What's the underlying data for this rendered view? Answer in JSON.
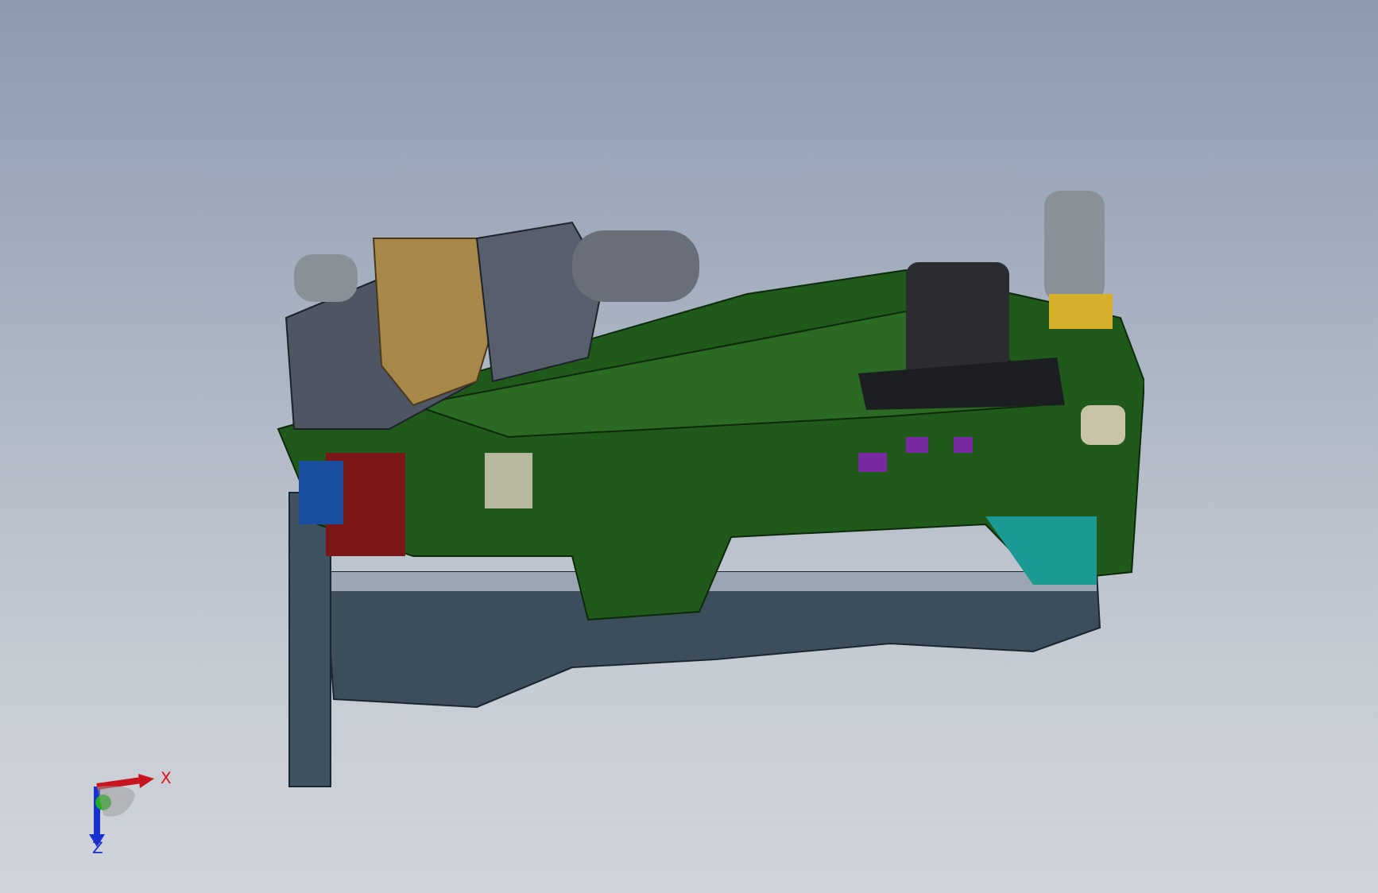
{
  "viewport": {
    "triad": [
      {
        "label": "X",
        "color": "#e0141e"
      },
      {
        "label": "Z",
        "color": "#1a2fd0"
      }
    ]
  }
}
